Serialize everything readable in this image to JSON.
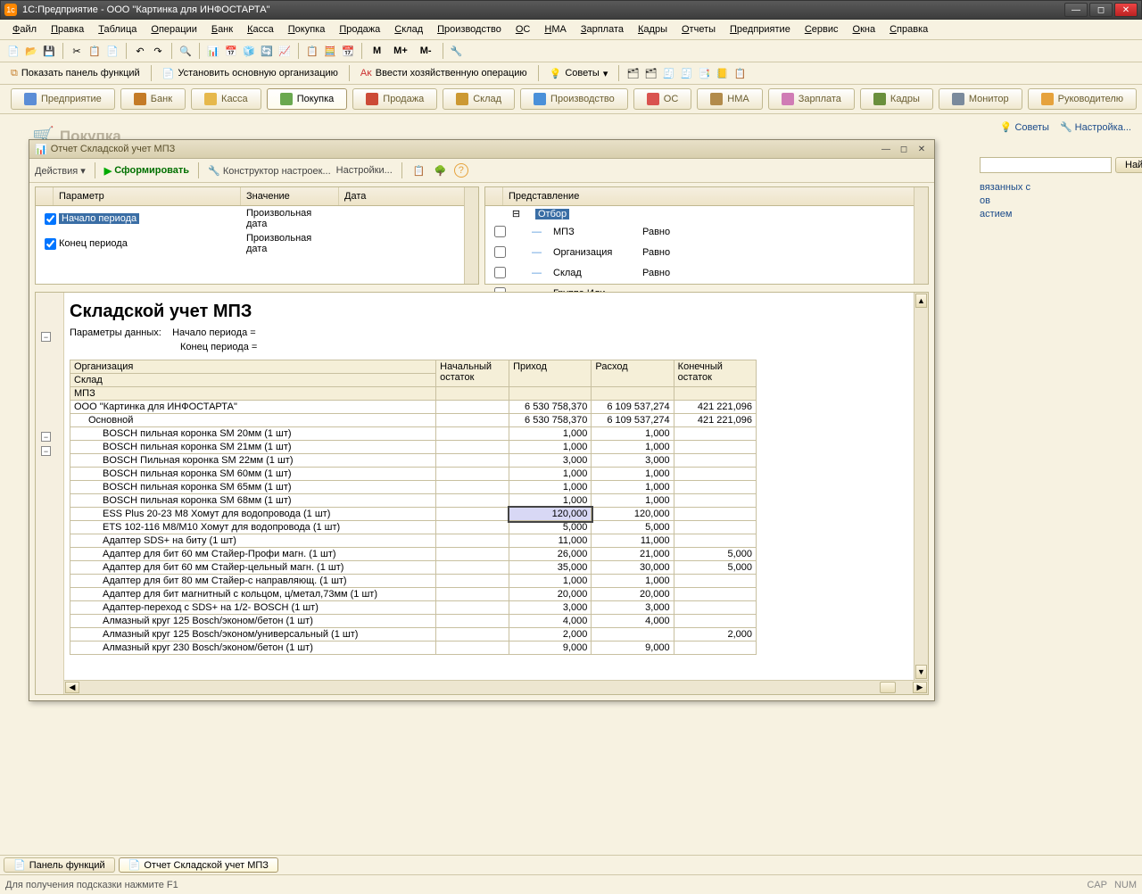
{
  "titlebar": {
    "title": "1С:Предприятие - ООО \"Картинка для ИНФОСТАРТА\""
  },
  "menubar": [
    "Файл",
    "Правка",
    "Таблица",
    "Операции",
    "Банк",
    "Касса",
    "Покупка",
    "Продажа",
    "Склад",
    "Производство",
    "ОС",
    "НМА",
    "Зарплата",
    "Кадры",
    "Отчеты",
    "Предприятие",
    "Сервис",
    "Окна",
    "Справка"
  ],
  "toolbar2": {
    "show_panel": "Показать панель функций",
    "set_org": "Установить основную организацию",
    "enter_op": "Ввести хозяйственную операцию",
    "tips": "Советы"
  },
  "bigtabs": [
    {
      "label": "Предприятие",
      "color": "#5b8dd6"
    },
    {
      "label": "Банк",
      "color": "#c47b27"
    },
    {
      "label": "Касса",
      "color": "#e6b84c"
    },
    {
      "label": "Покупка",
      "color": "#6aa84f",
      "active": true
    },
    {
      "label": "Продажа",
      "color": "#cc4b37"
    },
    {
      "label": "Склад",
      "color": "#cc9933"
    },
    {
      "label": "Производство",
      "color": "#4a90d9"
    },
    {
      "label": "ОС",
      "color": "#d9534f"
    },
    {
      "label": "НМА",
      "color": "#b28b4b"
    },
    {
      "label": "Зарплата",
      "color": "#d07cb5"
    },
    {
      "label": "Кадры",
      "color": "#6a8f3c"
    },
    {
      "label": "Монитор",
      "color": "#7a8a9c"
    },
    {
      "label": "Руководителю",
      "color": "#e6a23c"
    }
  ],
  "page": {
    "title": "Покупка"
  },
  "side_tips": {
    "tips": "Советы",
    "config": "Настройка..."
  },
  "sidepanel": {
    "find_btn": "Найти",
    "links": [
      "вязанных с",
      "ов",
      "астием"
    ]
  },
  "innerwin": {
    "title": "Отчет  Складской учет МПЗ",
    "toolbar": {
      "actions": "Действия",
      "form": "Сформировать",
      "constructor": "Конструктор настроек...",
      "settings": "Настройки..."
    },
    "params_left": {
      "headers": [
        "Параметр",
        "Значение",
        "Дата"
      ],
      "rows": [
        {
          "checked": true,
          "param": "Начало периода",
          "value": "Произвольная дата",
          "selected": true
        },
        {
          "checked": true,
          "param": "Конец периода",
          "value": "Произвольная дата"
        }
      ]
    },
    "params_right": {
      "header": "Представление",
      "root": "Отбор",
      "rows": [
        {
          "name": "МПЗ",
          "cond": "Равно"
        },
        {
          "name": "Организация",
          "cond": "Равно"
        },
        {
          "name": "Склад",
          "cond": "Равно"
        },
        {
          "name": "Группа Или",
          "cond": ""
        }
      ]
    },
    "report": {
      "title": "Складской учет МПЗ",
      "paramlabel": "Параметры данных:",
      "param1": "Начало периода =",
      "param2": "Конец периода =",
      "col_headers": [
        "Организация",
        "Начальный остаток",
        "Приход",
        "Расход",
        "Конечный остаток"
      ],
      "sub_headers": [
        "Склад",
        "МПЗ"
      ],
      "rows": [
        {
          "lvl": 0,
          "name": "ООО \"Картинка для ИНФОСТАРТА\"",
          "in": "6 530 758,370",
          "out": "6 109 537,274",
          "end": "421 221,096"
        },
        {
          "lvl": 1,
          "name": "Основной",
          "in": "6 530 758,370",
          "out": "6 109 537,274",
          "end": "421 221,096"
        },
        {
          "lvl": 2,
          "name": "BOSCH пильная коронка SM 20мм (1 шт)",
          "in": "1,000",
          "out": "1,000"
        },
        {
          "lvl": 2,
          "name": "BOSCH пильная коронка SM 21мм (1 шт)",
          "in": "1,000",
          "out": "1,000"
        },
        {
          "lvl": 2,
          "name": "BOSCH Пильная коронка SM 22мм (1 шт)",
          "in": "3,000",
          "out": "3,000"
        },
        {
          "lvl": 2,
          "name": "BOSCH пильная коронка SM 60мм (1 шт)",
          "in": "1,000",
          "out": "1,000"
        },
        {
          "lvl": 2,
          "name": "BOSCH пильная коронка SM 65мм (1 шт)",
          "in": "1,000",
          "out": "1,000"
        },
        {
          "lvl": 2,
          "name": "BOSCH пильная коронка SM 68мм (1 шт)",
          "in": "1,000",
          "out": "1,000"
        },
        {
          "lvl": 2,
          "name": "ESS Plus 20-23 M8 Хомут для водопровода    (1 шт)",
          "in": "120,000",
          "out": "120,000",
          "selected": true
        },
        {
          "lvl": 2,
          "name": "ETS 102-116 M8/M10  Хомут для водопровода    (1 шт)",
          "in": "5,000",
          "out": "5,000"
        },
        {
          "lvl": 2,
          "name": "Адаптер SDS+ на биту         (1 шт)",
          "in": "11,000",
          "out": "11,000"
        },
        {
          "lvl": 2,
          "name": "Адаптер для бит 60 мм Стайер-Профи  магн.    (1 шт)",
          "in": "26,000",
          "out": "21,000",
          "end": "5,000"
        },
        {
          "lvl": 2,
          "name": "Адаптер для бит 60 мм Стайер-цельный магн.  (1 шт)",
          "in": "35,000",
          "out": "30,000",
          "end": "5,000"
        },
        {
          "lvl": 2,
          "name": "Адаптер для бит 80 мм Стайер-с направляющ.  (1 шт)",
          "in": "1,000",
          "out": "1,000"
        },
        {
          "lvl": 2,
          "name": "Адаптер для бит магнитный с кольцом, ц/метал,73мм (1 шт)",
          "in": "20,000",
          "out": "20,000"
        },
        {
          "lvl": 2,
          "name": "Адаптер-переход с SDS+ на 1/2- BOSCH        (1 шт)",
          "in": "3,000",
          "out": "3,000"
        },
        {
          "lvl": 2,
          "name": "Алмазный круг 125 Bosch/эконом/бетон  (1 шт)",
          "in": "4,000",
          "out": "4,000"
        },
        {
          "lvl": 2,
          "name": "Алмазный круг 125 Bosch/эконом/универсальный (1 шт)",
          "in": "2,000",
          "out": "",
          "end": "2,000"
        },
        {
          "lvl": 2,
          "name": "Алмазный круг 230 Bosch/эконом/бетон (1 шт)",
          "in": "9,000",
          "out": "9,000"
        }
      ]
    }
  },
  "tasks": [
    {
      "label": "Панель функций"
    },
    {
      "label": "Отчет  Складской учет МПЗ",
      "active": true
    }
  ],
  "statusbar": {
    "hint": "Для получения подсказки нажмите F1",
    "cap": "CAP",
    "num": "NUM"
  }
}
